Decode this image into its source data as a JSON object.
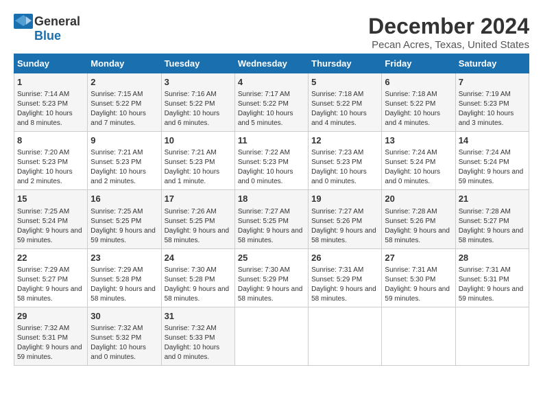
{
  "header": {
    "logo_general": "General",
    "logo_blue": "Blue",
    "month": "December 2024",
    "location": "Pecan Acres, Texas, United States"
  },
  "days_of_week": [
    "Sunday",
    "Monday",
    "Tuesday",
    "Wednesday",
    "Thursday",
    "Friday",
    "Saturday"
  ],
  "weeks": [
    [
      {
        "day": 1,
        "sunrise": "7:14 AM",
        "sunset": "5:23 PM",
        "daylight": "10 hours and 8 minutes."
      },
      {
        "day": 2,
        "sunrise": "7:15 AM",
        "sunset": "5:22 PM",
        "daylight": "10 hours and 7 minutes."
      },
      {
        "day": 3,
        "sunrise": "7:16 AM",
        "sunset": "5:22 PM",
        "daylight": "10 hours and 6 minutes."
      },
      {
        "day": 4,
        "sunrise": "7:17 AM",
        "sunset": "5:22 PM",
        "daylight": "10 hours and 5 minutes."
      },
      {
        "day": 5,
        "sunrise": "7:18 AM",
        "sunset": "5:22 PM",
        "daylight": "10 hours and 4 minutes."
      },
      {
        "day": 6,
        "sunrise": "7:18 AM",
        "sunset": "5:22 PM",
        "daylight": "10 hours and 4 minutes."
      },
      {
        "day": 7,
        "sunrise": "7:19 AM",
        "sunset": "5:23 PM",
        "daylight": "10 hours and 3 minutes."
      }
    ],
    [
      {
        "day": 8,
        "sunrise": "7:20 AM",
        "sunset": "5:23 PM",
        "daylight": "10 hours and 2 minutes."
      },
      {
        "day": 9,
        "sunrise": "7:21 AM",
        "sunset": "5:23 PM",
        "daylight": "10 hours and 2 minutes."
      },
      {
        "day": 10,
        "sunrise": "7:21 AM",
        "sunset": "5:23 PM",
        "daylight": "10 hours and 1 minute."
      },
      {
        "day": 11,
        "sunrise": "7:22 AM",
        "sunset": "5:23 PM",
        "daylight": "10 hours and 0 minutes."
      },
      {
        "day": 12,
        "sunrise": "7:23 AM",
        "sunset": "5:23 PM",
        "daylight": "10 hours and 0 minutes."
      },
      {
        "day": 13,
        "sunrise": "7:24 AM",
        "sunset": "5:24 PM",
        "daylight": "10 hours and 0 minutes."
      },
      {
        "day": 14,
        "sunrise": "7:24 AM",
        "sunset": "5:24 PM",
        "daylight": "9 hours and 59 minutes."
      }
    ],
    [
      {
        "day": 15,
        "sunrise": "7:25 AM",
        "sunset": "5:24 PM",
        "daylight": "9 hours and 59 minutes."
      },
      {
        "day": 16,
        "sunrise": "7:25 AM",
        "sunset": "5:25 PM",
        "daylight": "9 hours and 59 minutes."
      },
      {
        "day": 17,
        "sunrise": "7:26 AM",
        "sunset": "5:25 PM",
        "daylight": "9 hours and 58 minutes."
      },
      {
        "day": 18,
        "sunrise": "7:27 AM",
        "sunset": "5:25 PM",
        "daylight": "9 hours and 58 minutes."
      },
      {
        "day": 19,
        "sunrise": "7:27 AM",
        "sunset": "5:26 PM",
        "daylight": "9 hours and 58 minutes."
      },
      {
        "day": 20,
        "sunrise": "7:28 AM",
        "sunset": "5:26 PM",
        "daylight": "9 hours and 58 minutes."
      },
      {
        "day": 21,
        "sunrise": "7:28 AM",
        "sunset": "5:27 PM",
        "daylight": "9 hours and 58 minutes."
      }
    ],
    [
      {
        "day": 22,
        "sunrise": "7:29 AM",
        "sunset": "5:27 PM",
        "daylight": "9 hours and 58 minutes."
      },
      {
        "day": 23,
        "sunrise": "7:29 AM",
        "sunset": "5:28 PM",
        "daylight": "9 hours and 58 minutes."
      },
      {
        "day": 24,
        "sunrise": "7:30 AM",
        "sunset": "5:28 PM",
        "daylight": "9 hours and 58 minutes."
      },
      {
        "day": 25,
        "sunrise": "7:30 AM",
        "sunset": "5:29 PM",
        "daylight": "9 hours and 58 minutes."
      },
      {
        "day": 26,
        "sunrise": "7:31 AM",
        "sunset": "5:29 PM",
        "daylight": "9 hours and 58 minutes."
      },
      {
        "day": 27,
        "sunrise": "7:31 AM",
        "sunset": "5:30 PM",
        "daylight": "9 hours and 59 minutes."
      },
      {
        "day": 28,
        "sunrise": "7:31 AM",
        "sunset": "5:31 PM",
        "daylight": "9 hours and 59 minutes."
      }
    ],
    [
      {
        "day": 29,
        "sunrise": "7:32 AM",
        "sunset": "5:31 PM",
        "daylight": "9 hours and 59 minutes."
      },
      {
        "day": 30,
        "sunrise": "7:32 AM",
        "sunset": "5:32 PM",
        "daylight": "10 hours and 0 minutes."
      },
      {
        "day": 31,
        "sunrise": "7:32 AM",
        "sunset": "5:33 PM",
        "daylight": "10 hours and 0 minutes."
      },
      null,
      null,
      null,
      null
    ]
  ],
  "labels": {
    "sunrise": "Sunrise:",
    "sunset": "Sunset:",
    "daylight": "Daylight:"
  }
}
